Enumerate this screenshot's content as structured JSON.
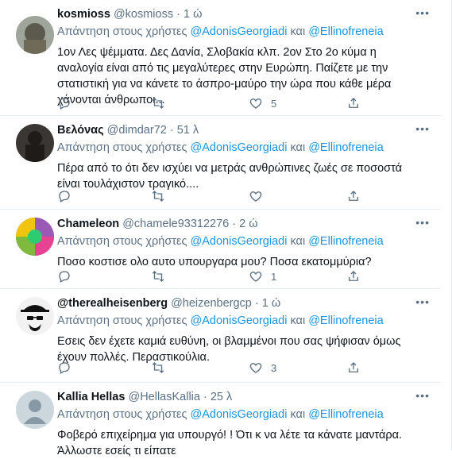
{
  "tweets": [
    {
      "name": "kosmioss",
      "handle": "@kosmioss",
      "time": "1 ώ",
      "reply_prefix": "Απάντηση στους χρήστες",
      "mention1": "@AdonisGeorgiadi",
      "and": "και",
      "mention2": "@Ellinofreneia",
      "text": "1ον Λες ψέμματα. Δες Δανία, Σλοβακία κλπ.  2ον Στο 2ο κύμα η αναλογία είναι από τις μεγαλύτερες στην Ευρώπη. Παίζετε με την στατιστική για να κάνετε το άσπρο-μαύρο την ώρα που κάθε μέρα χάνονται άνθρωποι...",
      "likes": "5",
      "avatar": "photo-avatar"
    },
    {
      "name": "Βελόνας",
      "handle": "@dimdar72",
      "time": "51 λ",
      "reply_prefix": "Απάντηση στους χρήστες",
      "mention1": "@AdonisGeorgiadi",
      "and": "και",
      "mention2": "@Ellinofreneia",
      "text": "Πέρα από το ότι δεν ισχύει να μετράς ανθρώπινες ζωές σε ποσοστά είναι τουλάχιστον τραγικό....",
      "likes": "",
      "avatar": "dark-silhouette-avatar"
    },
    {
      "name": "Chameleon",
      "handle": "@chamele93312276",
      "time": "2 ώ",
      "reply_prefix": "Απάντηση στους χρήστες",
      "mention1": "@AdonisGeorgiadi",
      "and": "και",
      "mention2": "@Ellinofreneia",
      "text": "Ποσο κοστισε ολο αυτο υπουργαρα μου? Ποσα εκατομμύρια?",
      "likes": "1",
      "avatar": "colorful-pattern-avatar"
    },
    {
      "name": "@therealheisenberg",
      "handle": "@heizenbergcp",
      "time": "1 ώ",
      "reply_prefix": "Απάντηση στους χρήστες",
      "mention1": "@AdonisGeorgiadi",
      "and": "και",
      "mention2": "@Ellinofreneia",
      "text": "Εσεις δεν έχετε καμιά ευθύνη, οι βλαμμένοι που σας ψήφισαν όμως έχουν πολλές. Περαστικούλια.",
      "likes": "3",
      "avatar": "heisenberg-avatar"
    },
    {
      "name": "Kallia Hellas",
      "handle": "@HellasKallia",
      "time": "25 λ",
      "reply_prefix": "Απάντηση στους χρήστες",
      "mention1": "@AdonisGeorgiadi",
      "and": "και",
      "mention2": "@Ellinofreneia",
      "text": "Φοβερό επιχείρημα για υπουργό! ! Ότι κ να λέτε τα κάνατε μαντάρα. Άλλωστε εσείς τι είπατε",
      "likes": "",
      "avatar": "default-avatar"
    }
  ],
  "separator": "·",
  "more_glyph": "•••",
  "colors": {
    "link": "#1b95e0",
    "muted": "#5b7083",
    "border": "#e6ecf0"
  }
}
